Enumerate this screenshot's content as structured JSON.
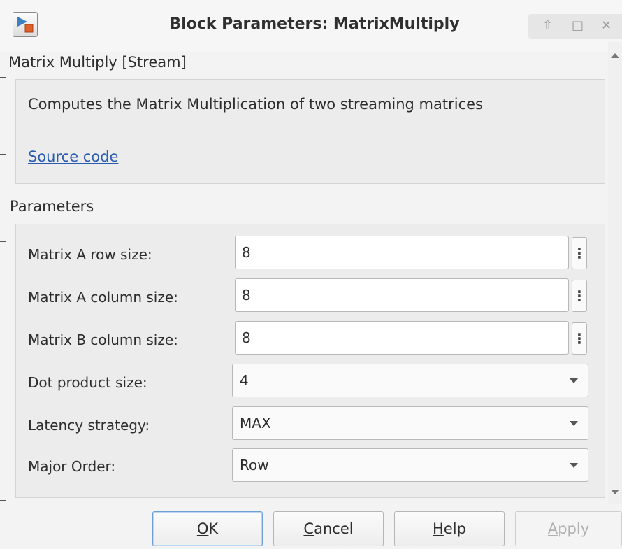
{
  "window": {
    "title": "Block Parameters: MatrixMultiply",
    "controls": {
      "up": "⇧",
      "maximize": "□",
      "close": "✕"
    }
  },
  "block": {
    "header": "Matrix Multiply [Stream]",
    "description": "Computes the Matrix Multiplication of two streaming matrices",
    "source_link": "Source code"
  },
  "params": {
    "section_title": "Parameters",
    "menu_glyph": "⋮",
    "row_a": {
      "label": "Matrix A row size:",
      "value": "8"
    },
    "col_a": {
      "label": "Matrix A column size:",
      "value": "8"
    },
    "col_b": {
      "label": "Matrix B column size:",
      "value": "8"
    },
    "dot_product": {
      "label": "Dot product size:",
      "value": "4"
    },
    "latency": {
      "label": "Latency strategy:",
      "value": "MAX"
    },
    "major_order": {
      "label": "Major Order:",
      "value": "Row"
    }
  },
  "buttons": {
    "ok": {
      "mnemonic": "O",
      "rest": "K"
    },
    "cancel": {
      "mnemonic": "C",
      "rest": "ancel"
    },
    "help": {
      "mnemonic": "H",
      "rest": "elp"
    },
    "apply": {
      "mnemonic": "A",
      "rest": "pply",
      "enabled": false
    }
  },
  "colors": {
    "link": "#2a5db0",
    "default_button_border": "#6b9fd6",
    "disabled_text": "#b0b0b0"
  }
}
